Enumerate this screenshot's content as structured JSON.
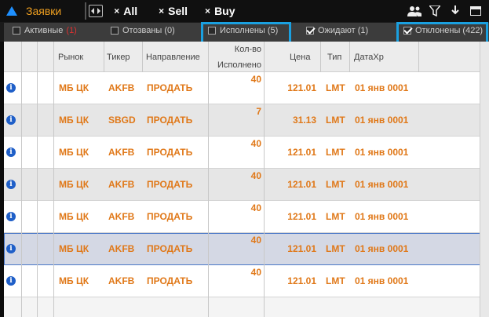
{
  "title": "Заявки",
  "toolbar": {
    "all_label": "All",
    "sell_label": "Sell",
    "buy_label": "Buy",
    "x_glyph": "×"
  },
  "filters": [
    {
      "label": "Активные",
      "count": "(1)",
      "checked": false,
      "highlighted": false
    },
    {
      "label": "Отозваны (0)",
      "checked": false,
      "highlighted": false
    },
    {
      "label": "Исполнены (5)",
      "checked": false,
      "highlighted": true
    },
    {
      "label": "Ожидают (1)",
      "checked": true,
      "highlighted": false
    },
    {
      "label": "Отклонены (422)",
      "checked": true,
      "highlighted": true
    }
  ],
  "columns": {
    "market": "Рынок",
    "ticker": "Тикер",
    "direction": "Направление",
    "qty_line1": "Кол-во",
    "qty_line2": "Исполнено",
    "price": "Цена",
    "type": "Тип",
    "date": "ДатаХр"
  },
  "rows": [
    {
      "market": "МБ ЦК",
      "ticker": "AKFB",
      "direction": "ПРОДАТЬ",
      "qty": "40",
      "price": "121.01",
      "type": "LMT",
      "date": "01 янв 0001",
      "selected": false
    },
    {
      "market": "МБ ЦК",
      "ticker": "SBGD",
      "direction": "ПРОДАТЬ",
      "qty": "7",
      "price": "31.13",
      "type": "LMT",
      "date": "01 янв 0001",
      "selected": false
    },
    {
      "market": "МБ ЦК",
      "ticker": "AKFB",
      "direction": "ПРОДАТЬ",
      "qty": "40",
      "price": "121.01",
      "type": "LMT",
      "date": "01 янв 0001",
      "selected": false
    },
    {
      "market": "МБ ЦК",
      "ticker": "AKFB",
      "direction": "ПРОДАТЬ",
      "qty": "40",
      "price": "121.01",
      "type": "LMT",
      "date": "01 янв 0001",
      "selected": false
    },
    {
      "market": "МБ ЦК",
      "ticker": "AKFB",
      "direction": "ПРОДАТЬ",
      "qty": "40",
      "price": "121.01",
      "type": "LMT",
      "date": "01 янв 0001",
      "selected": false
    },
    {
      "market": "МБ ЦК",
      "ticker": "AKFB",
      "direction": "ПРОДАТЬ",
      "qty": "40",
      "price": "121.01",
      "type": "LMT",
      "date": "01 янв 0001",
      "selected": true
    },
    {
      "market": "МБ ЦК",
      "ticker": "AKFB",
      "direction": "ПРОДАТЬ",
      "qty": "40",
      "price": "121.01",
      "type": "LMT",
      "date": "01 янв 0001",
      "selected": false
    }
  ],
  "info_glyph": "i",
  "icons": [
    "triangle-up-icon",
    "expand-icon",
    "users-icon",
    "filter-icon",
    "download-icon",
    "minimize-icon"
  ],
  "colors": {
    "accent": "#f0a020",
    "cell_text": "#e07818",
    "highlight": "#1aa0e0",
    "info": "#1f5fc8"
  }
}
